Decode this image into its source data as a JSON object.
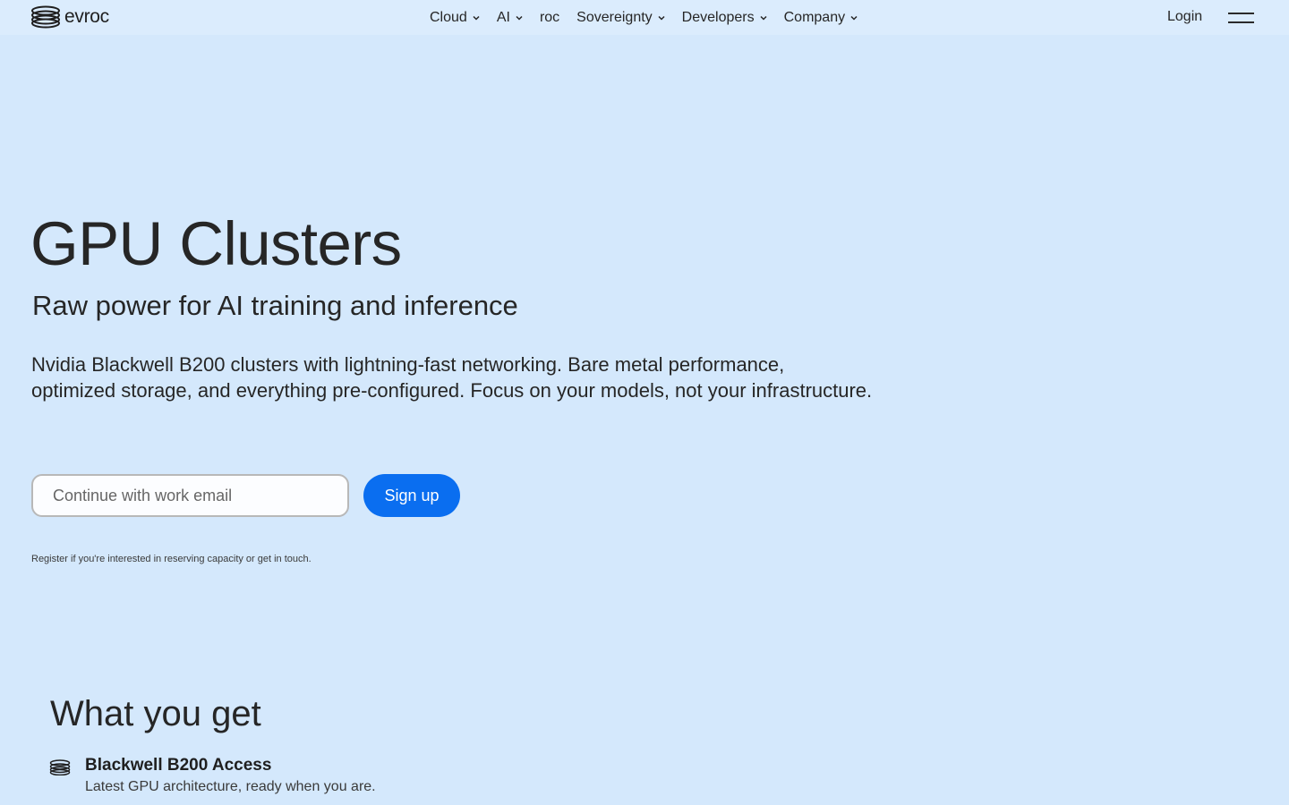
{
  "header": {
    "logo_text": "evroc",
    "nav": [
      {
        "label": "Cloud",
        "has_dropdown": true
      },
      {
        "label": "AI",
        "has_dropdown": true
      },
      {
        "label": "roc",
        "has_dropdown": false
      },
      {
        "label": "Sovereignty",
        "has_dropdown": true
      },
      {
        "label": "Developers",
        "has_dropdown": true
      },
      {
        "label": "Company",
        "has_dropdown": true
      }
    ],
    "login_label": "Login"
  },
  "hero": {
    "title": "GPU Clusters",
    "subtitle": "Raw power for AI training and inference",
    "description": "Nvidia Blackwell B200 clusters with lightning-fast networking. Bare metal performance, optimized storage, and everything pre-configured. Focus on your models, not your infrastructure.",
    "email_placeholder": "Continue with work email",
    "signup_label": "Sign up",
    "register_note": "Register if you're interested in reserving capacity or get in touch."
  },
  "features": {
    "title": "What you get",
    "items": [
      {
        "title": "Blackwell B200 Access",
        "description": "Latest GPU architecture, ready when you are.",
        "icon": "gpu-stack-icon"
      }
    ]
  },
  "colors": {
    "background": "#d4e8fc",
    "header_background": "#dbecfd",
    "accent": "#0a6ef0",
    "text": "#262626"
  }
}
